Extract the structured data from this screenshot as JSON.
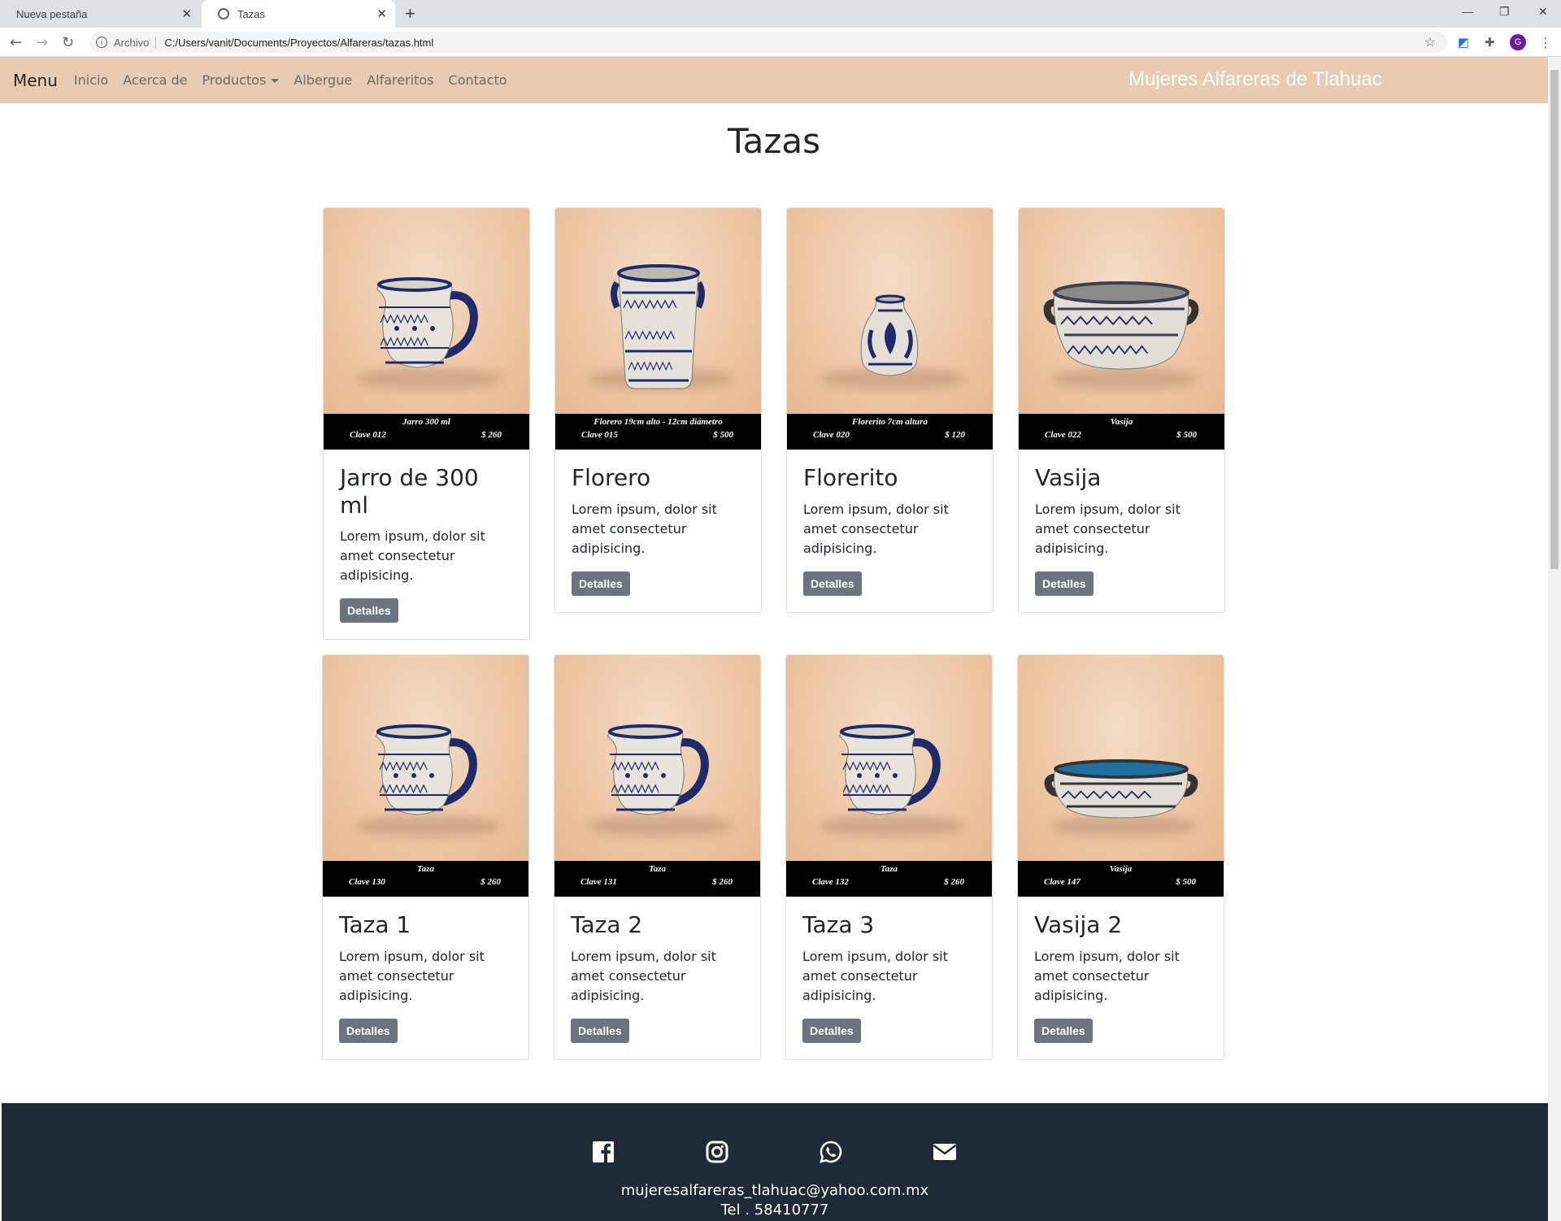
{
  "browser": {
    "tabs": [
      {
        "title": "Nueva pestaña"
      },
      {
        "title": "Tazas"
      }
    ],
    "address": {
      "scheme_label": "Archivo",
      "url": "C:/Users/vanit/Documents/Proyectos/Alfareras/tazas.html"
    },
    "profile_initial": "G"
  },
  "nav": {
    "brand": "Menu",
    "links": [
      "Inicio",
      "Acerca de",
      "Productos",
      "Albergue",
      "Alfareritos",
      "Contacto"
    ],
    "site_title": "Mujeres Alfareras de Tlahuac"
  },
  "page": {
    "title": "Tazas"
  },
  "products": [
    {
      "title": "Jarro de 300 ml",
      "text": "Lorem ipsum, dolor sit amet consectetur adipisicing.",
      "button": "Detalles",
      "caption": {
        "name": "Jarro 300 ml",
        "clave": "Clave 012",
        "price": "$ 260"
      },
      "piece": "mug"
    },
    {
      "title": "Florero",
      "text": "Lorem ipsum, dolor sit amet consectetur adipisicing.",
      "button": "Detalles",
      "caption": {
        "name": "Florero 19cm alto - 12cm diámetro",
        "clave": "Clave 015",
        "price": "$ 500"
      },
      "piece": "vase-tall"
    },
    {
      "title": "Florerito",
      "text": "Lorem ipsum, dolor sit amet consectetur adipisicing.",
      "button": "Detalles",
      "caption": {
        "name": "Florerito 7cm altura",
        "clave": "Clave 020",
        "price": "$ 120"
      },
      "piece": "vase-small"
    },
    {
      "title": "Vasija",
      "text": "Lorem ipsum, dolor sit amet consectetur adipisicing.",
      "button": "Detalles",
      "caption": {
        "name": "Vasija",
        "clave": "Clave 022",
        "price": "$ 500"
      },
      "piece": "bowl"
    },
    {
      "title": "Taza 1",
      "text": "Lorem ipsum, dolor sit amet consectetur adipisicing.",
      "button": "Detalles",
      "caption": {
        "name": "Taza",
        "clave": "Clave 130",
        "price": "$ 260"
      },
      "piece": "mug"
    },
    {
      "title": "Taza 2",
      "text": "Lorem ipsum, dolor sit amet consectetur adipisicing.",
      "button": "Detalles",
      "caption": {
        "name": "Taza",
        "clave": "Clave 131",
        "price": "$ 260"
      },
      "piece": "mug"
    },
    {
      "title": "Taza 3",
      "text": "Lorem ipsum, dolor sit amet consectetur adipisicing.",
      "button": "Detalles",
      "caption": {
        "name": "Taza",
        "clave": "Clave 132",
        "price": "$ 260"
      },
      "piece": "mug"
    },
    {
      "title": "Vasija 2",
      "text": "Lorem ipsum, dolor sit amet consectetur adipisicing.",
      "button": "Detalles",
      "caption": {
        "name": "Vasija",
        "clave": "Clave 147",
        "price": "$ 500"
      },
      "piece": "bowl-low"
    }
  ],
  "footer": {
    "icons": [
      "facebook-icon",
      "instagram-icon",
      "whatsapp-icon",
      "envelope-icon"
    ],
    "email": "mujeresalfareras_tlahuac@yahoo.com.mx",
    "phone": "Tel . 58410777"
  },
  "colors": {
    "navbar": "#e8cbb2",
    "footer": "#1f2a36",
    "button": "#6c757d",
    "glaze_blue": "#1f2a6b"
  }
}
